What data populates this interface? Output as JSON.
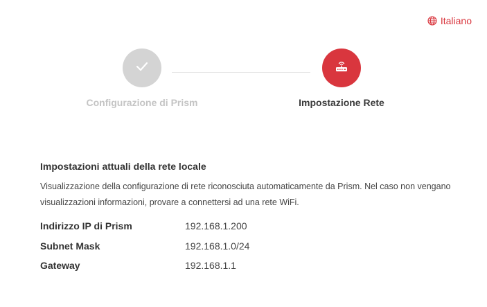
{
  "language": {
    "label": "Italiano",
    "icon": "globe-icon",
    "color": "#d9363e"
  },
  "steps": [
    {
      "label": "Configurazione di Prism",
      "state": "completed",
      "icon": "check-icon"
    },
    {
      "label": "Impostazione Rete",
      "state": "active",
      "icon": "router-icon"
    }
  ],
  "colors": {
    "accent": "#d9363e",
    "completed": "#d4d4d4"
  },
  "network": {
    "title": "Impostazioni attuali della rete locale",
    "description": "Visualizzazione della configurazione di rete riconosciuta automaticamente da Prism. Nel caso non vengano visualizzazioni informazioni, provare a connettersi ad una rete WiFi.",
    "rows": [
      {
        "label": "Indirizzo IP di Prism",
        "value": "192.168.1.200"
      },
      {
        "label": "Subnet Mask",
        "value": "192.168.1.0/24"
      },
      {
        "label": "Gateway",
        "value": "192.168.1.1"
      }
    ]
  }
}
